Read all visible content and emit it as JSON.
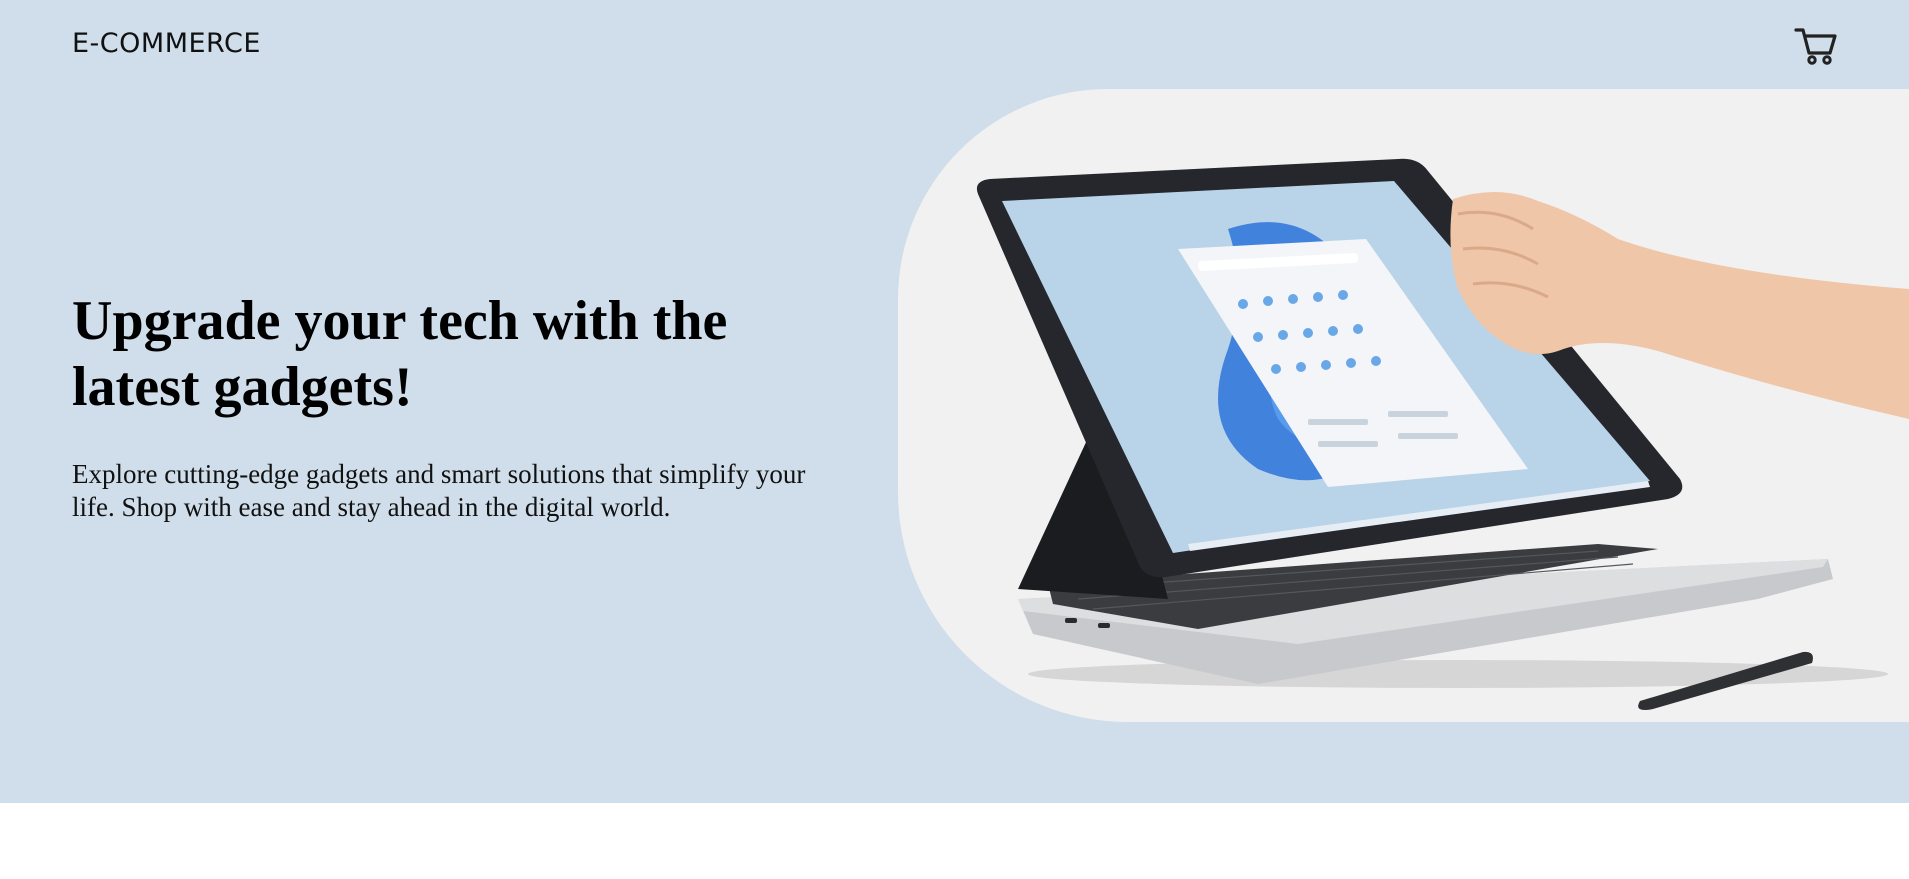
{
  "header": {
    "brand": "E-COMMERCE",
    "cart_icon": "shopping-cart-icon"
  },
  "hero": {
    "headline": "Upgrade your tech with the latest gadgets!",
    "subtext": "Explore cutting-edge gadgets and smart solutions that simplify your life. Shop with ease and stay ahead in the digital world.",
    "image": "laptop-with-hand-and-stylus"
  },
  "colors": {
    "hero_background": "#cfdeea",
    "image_panel": "#f1f1f1",
    "text": "#000000"
  }
}
